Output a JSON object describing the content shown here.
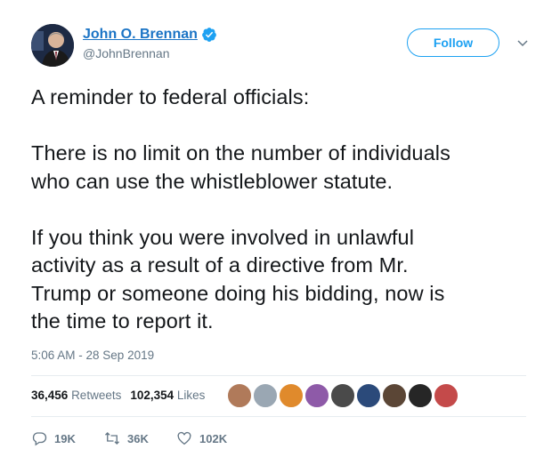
{
  "author": {
    "display_name": "John O. Brennan",
    "handle": "@JohnBrennan"
  },
  "follow_button": {
    "label": "Follow"
  },
  "tweet": {
    "text": "A reminder to federal officials:\n\nThere is no limit on the number of individuals\nwho can use the whistleblower statute.\n\nIf you think you were involved in unlawful\nactivity as a result of a directive from Mr.\nTrump or someone doing his bidding, now is\nthe time to report it.",
    "timestamp": "5:06 AM - 28 Sep 2019"
  },
  "stats": {
    "retweets_count": "36,456",
    "retweets_label": "Retweets",
    "likes_count": "102,354",
    "likes_label": "Likes"
  },
  "likers": [
    {
      "name": "liker-1",
      "color": "#b07a5a"
    },
    {
      "name": "liker-2",
      "color": "#9aa7b3"
    },
    {
      "name": "liker-3",
      "color": "#e08a2c"
    },
    {
      "name": "liker-4",
      "color": "#8e5aa8"
    },
    {
      "name": "liker-5",
      "color": "#4a4a4a"
    },
    {
      "name": "liker-6",
      "color": "#2b4a7a"
    },
    {
      "name": "liker-7",
      "color": "#5b4636"
    },
    {
      "name": "liker-8",
      "color": "#262626"
    },
    {
      "name": "liker-9",
      "color": "#c44a4a"
    }
  ],
  "actions": {
    "reply_count": "19K",
    "retweet_count": "36K",
    "like_count": "102K"
  },
  "colors": {
    "accent": "#1da1f2",
    "name_link": "#1b74c5",
    "secondary_text": "#657786"
  },
  "icons": [
    "verified-icon",
    "chevron-down-icon",
    "reply-icon",
    "retweet-icon",
    "like-icon"
  ]
}
